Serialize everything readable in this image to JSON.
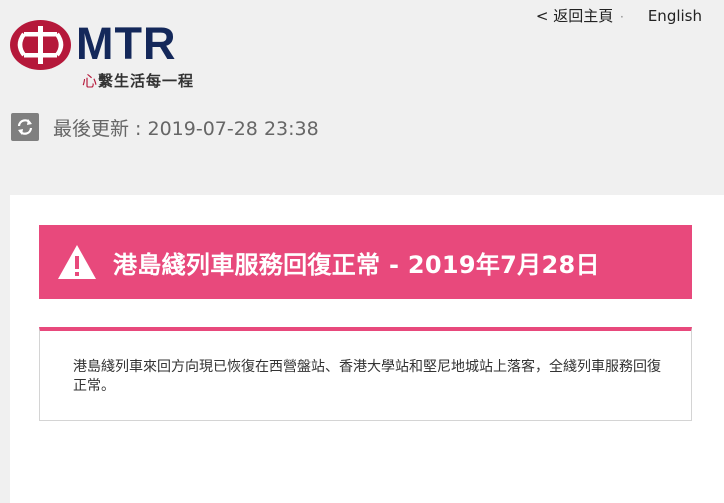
{
  "header": {
    "brand": "MTR",
    "tagline_prefix": "心",
    "tagline": "繫生活每一程",
    "back_link": "< 返回主頁",
    "back_sep": "·",
    "language_link": "English"
  },
  "update": {
    "label": "最後更新 : 2019-07-28 23:38"
  },
  "alert": {
    "title": "港島綫列車服務回復正常 - 2019年7月28日",
    "detail": "港島綫列車來回方向現已恢復在西營盤站、香港大學站和堅尼地城站上落客，全綫列車服務回復正常。"
  },
  "colors": {
    "brand_red": "#b5183a",
    "brand_navy": "#14285a",
    "alert_pink": "#e8497c"
  },
  "icons": {
    "logo": "mtr-logo-icon",
    "refresh": "refresh-icon",
    "warning": "warning-icon"
  }
}
